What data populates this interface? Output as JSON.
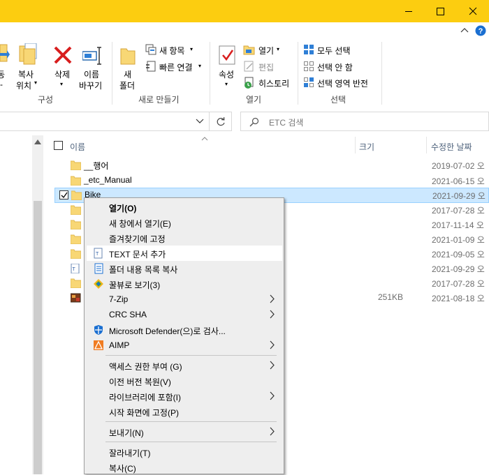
{
  "window": {
    "controls": {
      "minimize": "minimize-icon",
      "maximize": "maximize-icon",
      "close": "close-icon"
    }
  },
  "ribbon": {
    "move_to_l1": "동",
    "move_to_l2": "-",
    "copy_to_l1": "복사",
    "copy_to_l2": "위치",
    "delete_label": "삭제",
    "rename_l1": "이름",
    "rename_l2": "바꾸기",
    "group_organize": "구성",
    "new_folder_l1": "새",
    "new_folder_l2": "폴더",
    "new_item": "새 항목",
    "easy_access": "빠른 연결",
    "group_new": "새로 만들기",
    "properties": "속성",
    "open": "열기",
    "edit": "편집",
    "history": "히스토리",
    "group_open": "열기",
    "select_all": "모두 선택",
    "select_none": "선택 안 함",
    "invert_selection": "선택 영역 반전",
    "group_select": "선택"
  },
  "addressbar": {
    "search_placeholder": "ETC 검색"
  },
  "filelist": {
    "columns": {
      "name": "이름",
      "size": "크기",
      "modified": "수정한 날짜"
    },
    "rows": [
      {
        "name": "__행어",
        "date": "2019-07-02 오",
        "size": "",
        "type": "folder"
      },
      {
        "name": "_etc_Manual",
        "date": "2021-06-15 오",
        "size": "",
        "type": "folder"
      },
      {
        "name": "Bike",
        "date": "2021-09-29 오",
        "size": "",
        "type": "folder",
        "selected": true
      },
      {
        "name": "",
        "date": "2017-07-28 오",
        "size": "",
        "type": "folder"
      },
      {
        "name": "",
        "date": "2017-11-14 오",
        "size": "",
        "type": "folder"
      },
      {
        "name": "",
        "date": "2021-01-09 오",
        "size": "",
        "type": "folder"
      },
      {
        "name": "",
        "date": "2021-09-05 오",
        "size": "",
        "type": "folder"
      },
      {
        "name": "",
        "date": "2021-09-29 오",
        "size": "",
        "type": "text"
      },
      {
        "name": "",
        "date": "2017-07-28 오",
        "size": "",
        "type": "folder"
      },
      {
        "name": "",
        "date": "2021-08-18 오",
        "size": "251KB",
        "type": "image"
      }
    ]
  },
  "context_menu": {
    "items": [
      {
        "label": "열기(O)",
        "bold": true
      },
      {
        "label": "새 창에서 열기(E)"
      },
      {
        "label": "즐겨찾기에 고정"
      },
      {
        "label": "TEXT 문서 추가",
        "icon": "text-document-icon",
        "highlight": true
      },
      {
        "label": "폴더 내용 목록 복사",
        "icon": "copy-list-icon"
      },
      {
        "label": "꿀뷰로 보기(3)",
        "icon": "honeyview-icon"
      },
      {
        "label": "7-Zip",
        "submenu": true
      },
      {
        "label": "CRC SHA",
        "submenu": true
      },
      {
        "label": "Microsoft Defender(으)로 검사...",
        "icon": "defender-icon"
      },
      {
        "label": "AIMP",
        "icon": "aimp-icon",
        "submenu": true
      },
      {
        "label": "액세스 권한 부여 (G)",
        "submenu": true
      },
      {
        "label": "이전 버전 복원(V)"
      },
      {
        "label": "라이브러리에 포함(I)",
        "submenu": true
      },
      {
        "label": "시작 화면에 고정(P)"
      },
      {
        "label": "보내기(N)",
        "submenu": true
      },
      {
        "label": "잘라내기(T)"
      },
      {
        "label": "복사(C)"
      }
    ]
  }
}
